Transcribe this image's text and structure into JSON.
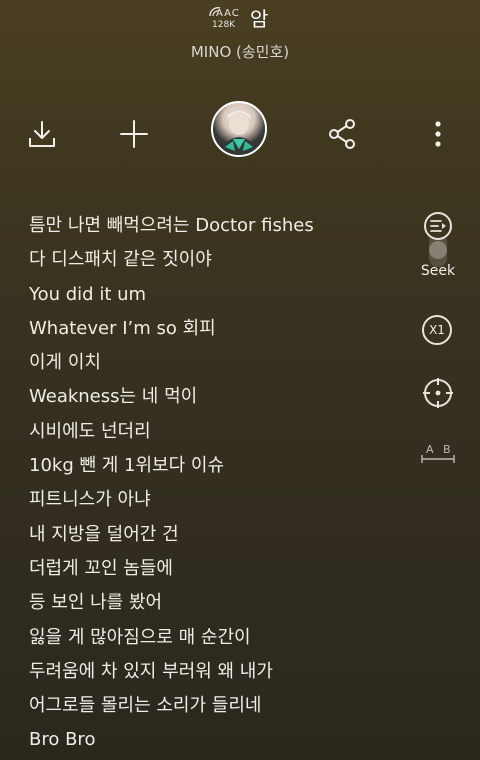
{
  "header": {
    "codec_format": "AAC",
    "codec_bitrate": "128K",
    "song_title": "암",
    "artist": "MINO (송민호)"
  },
  "toolbar": {
    "items": [
      {
        "name": "download-icon"
      },
      {
        "name": "add-icon"
      },
      {
        "name": "artist-avatar"
      },
      {
        "name": "share-icon"
      },
      {
        "name": "more-vertical-icon"
      }
    ]
  },
  "lyrics": [
    "틈만 나면 빼먹으려는 Doctor fishes",
    "다 디스패치 같은 짓이야",
    "You did it um",
    "Whatever I’m so 회피",
    "이게 이치",
    "Weakness는 네 먹이",
    "시비에도 넌더리",
    "10kg 뺀 게 1위보다 이슈",
    "피트니스가 아냐",
    "내 지방을 덜어간 건",
    "더럽게 꼬인 놈들에",
    "등 보인 나를 봤어",
    "잃을 게 많아짐으로 매 순간이",
    "두려움에 차 있지 부러워 왜 내가",
    "어그로들 몰리는 소리가 들리네",
    "Bro Bro"
  ],
  "side_controls": {
    "seek_label": "Seek",
    "speed_label": "X1",
    "ab_label": "A B",
    "icons": [
      "lyrics-seek-icon",
      "speed-icon",
      "locate-icon",
      "ab-repeat-icon"
    ]
  },
  "colors": {
    "background_top": "#4a3f22",
    "background_bottom": "#2a271d",
    "text": "#efede6"
  }
}
